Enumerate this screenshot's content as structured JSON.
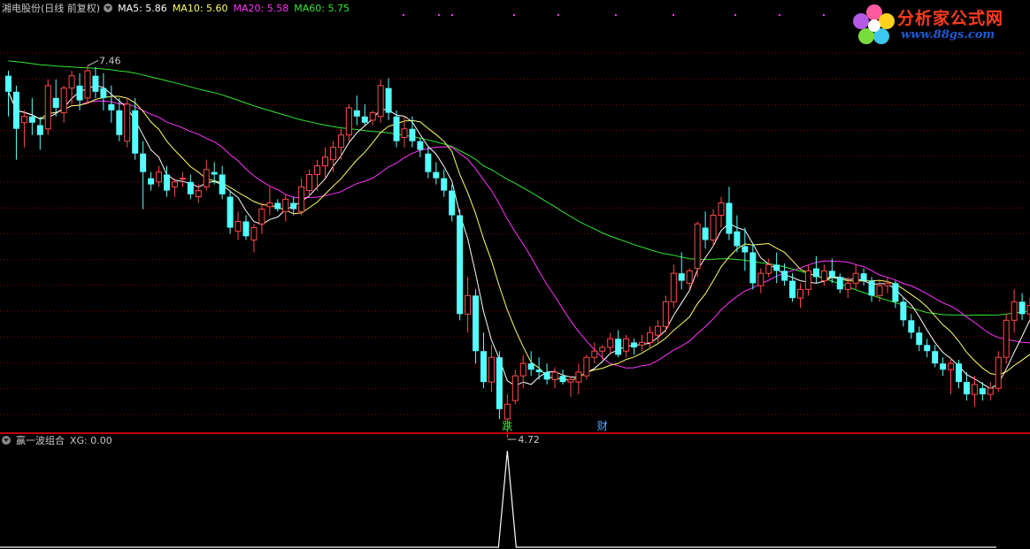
{
  "header": {
    "title": "湘电股份(日线 前复权)",
    "ma5_label": "MA5: 5.86",
    "ma10_label": "MA10: 5.60",
    "ma20_label": "MA20: 5.58",
    "ma60_label": "MA60: 5.75"
  },
  "indicator": {
    "title": "赢一波组合",
    "xg_label": "XG: 0.00"
  },
  "logo": {
    "name": "分析家公式网",
    "url": "www.88gs.com"
  },
  "annotations": {
    "high_label": "7.46",
    "low_label": "4.72",
    "signal_1": "跌",
    "signal_2": "财"
  },
  "colors": {
    "up": "#ff4b4b",
    "down": "#54ffff",
    "ma5": "#ffffff",
    "ma10": "#ffff64",
    "ma20": "#ff32ff",
    "ma60": "#32e632",
    "grid": "#8b0000",
    "divider": "#c80000",
    "signal_1": "#3cdc3c",
    "signal_2": "#5aaaff"
  },
  "chart_data": {
    "type": "candlestick",
    "ohlc": [
      [
        7.38,
        7.42,
        7.05,
        7.25
      ],
      [
        7.25,
        7.3,
        6.7,
        6.95
      ],
      [
        7.0,
        7.1,
        6.8,
        7.05
      ],
      [
        7.05,
        7.2,
        6.9,
        7.0
      ],
      [
        6.98,
        7.05,
        6.78,
        6.9
      ],
      [
        6.95,
        7.35,
        6.9,
        7.3
      ],
      [
        7.2,
        7.35,
        7.05,
        7.12
      ],
      [
        7.08,
        7.3,
        7.0,
        7.28
      ],
      [
        7.28,
        7.42,
        7.15,
        7.38
      ],
      [
        7.3,
        7.4,
        7.1,
        7.18
      ],
      [
        7.2,
        7.46,
        7.15,
        7.42
      ],
      [
        7.38,
        7.45,
        7.2,
        7.25
      ],
      [
        7.28,
        7.4,
        7.1,
        7.2
      ],
      [
        7.15,
        7.3,
        7.0,
        7.1
      ],
      [
        7.1,
        7.2,
        6.85,
        6.9
      ],
      [
        6.85,
        7.2,
        6.8,
        7.15
      ],
      [
        7.1,
        7.2,
        6.7,
        6.75
      ],
      [
        6.75,
        6.85,
        6.3,
        6.6
      ],
      [
        6.55,
        6.6,
        6.45,
        6.5
      ],
      [
        6.52,
        6.65,
        6.48,
        6.6
      ],
      [
        6.58,
        6.65,
        6.4,
        6.45
      ],
      [
        6.48,
        6.55,
        6.4,
        6.52
      ],
      [
        6.55,
        6.6,
        6.48,
        6.55
      ],
      [
        6.52,
        6.58,
        6.38,
        6.42
      ],
      [
        6.4,
        6.5,
        6.35,
        6.45
      ],
      [
        6.48,
        6.7,
        6.45,
        6.62
      ],
      [
        6.6,
        6.68,
        6.5,
        6.58
      ],
      [
        6.58,
        6.65,
        6.38,
        6.42
      ],
      [
        6.4,
        6.45,
        6.1,
        6.15
      ],
      [
        6.12,
        6.28,
        6.05,
        6.2
      ],
      [
        6.2,
        6.25,
        6.05,
        6.08
      ],
      [
        6.05,
        6.18,
        5.95,
        6.15
      ],
      [
        6.18,
        6.35,
        6.1,
        6.3
      ],
      [
        6.32,
        6.48,
        6.25,
        6.35
      ],
      [
        6.35,
        6.38,
        6.28,
        6.3
      ],
      [
        6.28,
        6.42,
        6.2,
        6.38
      ],
      [
        6.35,
        6.4,
        6.25,
        6.3
      ],
      [
        6.28,
        6.55,
        6.25,
        6.48
      ],
      [
        6.45,
        6.62,
        6.4,
        6.58
      ],
      [
        6.58,
        6.7,
        6.45,
        6.65
      ],
      [
        6.65,
        6.8,
        6.55,
        6.72
      ],
      [
        6.7,
        6.85,
        6.6,
        6.8
      ],
      [
        6.8,
        6.95,
        6.7,
        6.9
      ],
      [
        6.9,
        7.15,
        6.85,
        7.12
      ],
      [
        7.1,
        7.22,
        6.98,
        7.05
      ],
      [
        7.05,
        7.15,
        6.98,
        7.0
      ],
      [
        7.02,
        7.1,
        6.98,
        7.08
      ],
      [
        7.05,
        7.35,
        7.0,
        7.3
      ],
      [
        7.28,
        7.36,
        7.02,
        7.08
      ],
      [
        7.05,
        7.1,
        6.8,
        6.85
      ],
      [
        6.88,
        7.05,
        6.8,
        6.95
      ],
      [
        6.95,
        7.05,
        6.8,
        6.85
      ],
      [
        6.85,
        6.88,
        6.72,
        6.78
      ],
      [
        6.75,
        6.8,
        6.55,
        6.6
      ],
      [
        6.6,
        6.68,
        6.5,
        6.55
      ],
      [
        6.55,
        6.62,
        6.4,
        6.45
      ],
      [
        6.45,
        6.5,
        6.2,
        6.25
      ],
      [
        6.25,
        6.3,
        5.4,
        5.45
      ],
      [
        5.45,
        5.75,
        5.3,
        5.6
      ],
      [
        5.6,
        5.65,
        5.05,
        5.15
      ],
      [
        5.15,
        5.3,
        4.85,
        4.9
      ],
      [
        4.9,
        5.2,
        4.82,
        5.1
      ],
      [
        5.1,
        5.15,
        4.6,
        4.68
      ],
      [
        4.6,
        4.8,
        4.45,
        4.72
      ],
      [
        4.75,
        5.0,
        4.72,
        4.95
      ],
      [
        4.95,
        5.12,
        4.85,
        5.05
      ],
      [
        5.05,
        5.15,
        4.95,
        5.0
      ],
      [
        5.0,
        5.1,
        4.92,
        4.98
      ],
      [
        4.98,
        5.05,
        4.88,
        4.92
      ],
      [
        4.92,
        5.02,
        4.85,
        4.98
      ],
      [
        4.95,
        5.0,
        4.88,
        4.9
      ],
      [
        4.9,
        4.95,
        4.78,
        4.92
      ],
      [
        4.9,
        5.05,
        4.8,
        4.98
      ],
      [
        4.95,
        5.12,
        4.92,
        5.1
      ],
      [
        5.1,
        5.22,
        5.05,
        5.15
      ],
      [
        5.15,
        5.2,
        5.08,
        5.18
      ],
      [
        5.18,
        5.3,
        5.12,
        5.25
      ],
      [
        5.25,
        5.32,
        5.1,
        5.12
      ],
      [
        5.15,
        5.28,
        5.1,
        5.25
      ],
      [
        5.22,
        5.25,
        5.12,
        5.18
      ],
      [
        5.2,
        5.28,
        5.15,
        5.22
      ],
      [
        5.22,
        5.35,
        5.18,
        5.3
      ],
      [
        5.28,
        5.4,
        5.22,
        5.35
      ],
      [
        5.35,
        5.6,
        5.3,
        5.55
      ],
      [
        5.55,
        5.85,
        5.5,
        5.78
      ],
      [
        5.78,
        5.95,
        5.65,
        5.72
      ],
      [
        5.7,
        5.82,
        5.65,
        5.8
      ],
      [
        5.82,
        6.2,
        5.75,
        6.18
      ],
      [
        6.15,
        6.28,
        5.98,
        6.05
      ],
      [
        6.05,
        6.3,
        6.0,
        6.25
      ],
      [
        6.25,
        6.4,
        6.15,
        6.35
      ],
      [
        6.35,
        6.48,
        6.05,
        6.1
      ],
      [
        6.12,
        6.25,
        5.95,
        6.0
      ],
      [
        6.0,
        6.15,
        5.8,
        5.95
      ],
      [
        5.95,
        6.02,
        5.65,
        5.7
      ],
      [
        5.68,
        5.82,
        5.62,
        5.78
      ],
      [
        5.78,
        5.9,
        5.75,
        5.85
      ],
      [
        5.85,
        5.95,
        5.7,
        5.8
      ],
      [
        5.8,
        5.86,
        5.68,
        5.72
      ],
      [
        5.72,
        5.78,
        5.55,
        5.58
      ],
      [
        5.58,
        5.7,
        5.5,
        5.65
      ],
      [
        5.65,
        5.85,
        5.6,
        5.8
      ],
      [
        5.82,
        5.92,
        5.7,
        5.75
      ],
      [
        5.72,
        5.85,
        5.68,
        5.8
      ],
      [
        5.8,
        5.9,
        5.7,
        5.75
      ],
      [
        5.75,
        5.78,
        5.62,
        5.65
      ],
      [
        5.65,
        5.75,
        5.58,
        5.7
      ],
      [
        5.7,
        5.85,
        5.65,
        5.78
      ],
      [
        5.78,
        5.82,
        5.68,
        5.72
      ],
      [
        5.72,
        5.75,
        5.55,
        5.6
      ],
      [
        5.6,
        5.72,
        5.55,
        5.68
      ],
      [
        5.68,
        5.75,
        5.62,
        5.7
      ],
      [
        5.7,
        5.72,
        5.5,
        5.55
      ],
      [
        5.55,
        5.58,
        5.35,
        5.4
      ],
      [
        5.4,
        5.45,
        5.25,
        5.3
      ],
      [
        5.3,
        5.35,
        5.15,
        5.2
      ],
      [
        5.2,
        5.25,
        5.1,
        5.15
      ],
      [
        5.15,
        5.2,
        5.02,
        5.05
      ],
      [
        5.05,
        5.1,
        4.95,
        5.0
      ],
      [
        5.0,
        5.1,
        4.8,
        5.05
      ],
      [
        5.05,
        5.08,
        4.85,
        4.9
      ],
      [
        4.9,
        4.98,
        4.75,
        4.8
      ],
      [
        4.8,
        4.95,
        4.7,
        4.88
      ],
      [
        4.85,
        4.9,
        4.75,
        4.8
      ],
      [
        4.8,
        4.9,
        4.75,
        4.85
      ],
      [
        4.85,
        5.15,
        4.82,
        5.1
      ],
      [
        5.1,
        5.45,
        5.05,
        5.4
      ],
      [
        5.4,
        5.65,
        5.3,
        5.55
      ],
      [
        5.55,
        5.62,
        5.4,
        5.45
      ],
      [
        5.45,
        5.58,
        5.38,
        5.52
      ],
      [
        5.52,
        5.55,
        5.4,
        5.42
      ],
      [
        5.42,
        5.72,
        5.4,
        5.68
      ]
    ],
    "ma_periods": {
      "MA5": 5,
      "MA10": 10,
      "MA20": 20,
      "MA60": 60
    },
    "ylim": [
      4.5,
      7.85
    ],
    "signal_days": [
      63,
      75
    ],
    "xg": {
      "spike_day": 63,
      "value": 1,
      "last": 0
    }
  }
}
